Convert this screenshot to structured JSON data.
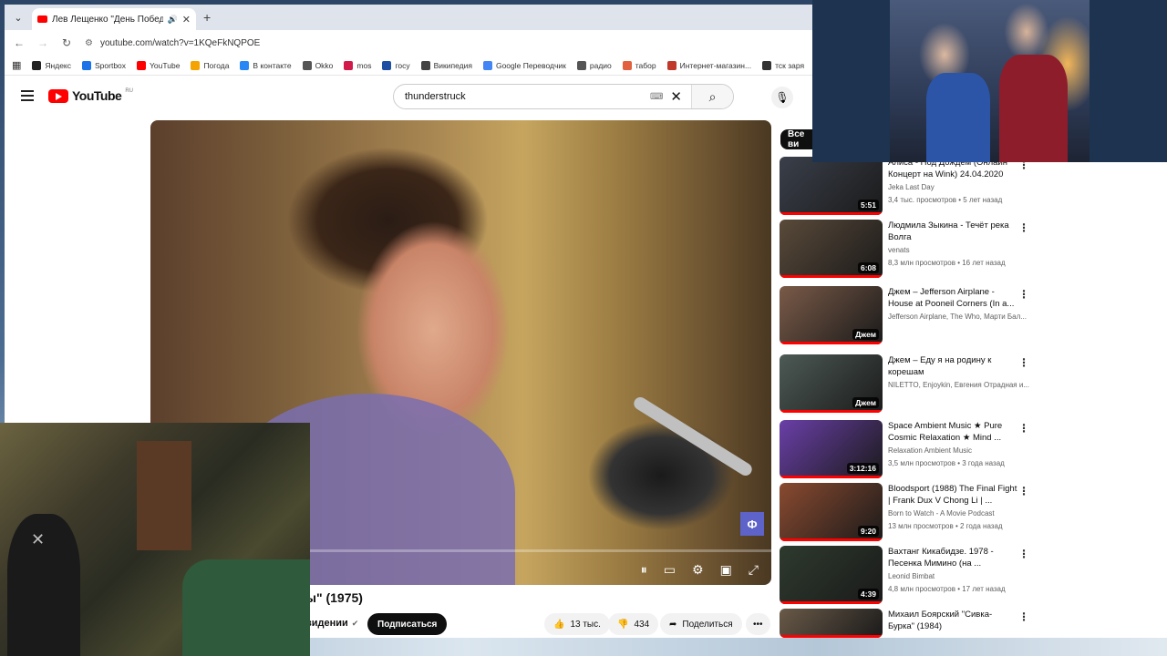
{
  "browser": {
    "tab_title": "Лев Лещенко \"День Побед",
    "url": "youtube.com/watch?v=1KQeFkNQPOE",
    "bookmarks": [
      "Яндекс",
      "Sportbox",
      "YouTube",
      "Погода",
      "В контакте",
      "Okko",
      "mos",
      "госу",
      "Википедия",
      "Google Переводчик",
      "радио",
      "табор",
      "Интернет-магазин...",
      "тск заря"
    ],
    "bookmark_colors": [
      "#222222",
      "#1a73e8",
      "#ff0000",
      "#f4a300",
      "#2787f5",
      "#555555",
      "#d11a4a",
      "#1e4fa3",
      "#444444",
      "#4285f4",
      "#555555",
      "#e06040",
      "#c0392b",
      "#333333"
    ]
  },
  "youtube": {
    "logo_text": "YouTube",
    "region": "RU",
    "search_query": "thunderstruck",
    "filter_chip": "Все ви",
    "video_title_partial": "ы\" (1975)",
    "channel_partial": "видении",
    "subscribe_label": "Подписаться",
    "likes": "13 тыс.",
    "dislikes": "434",
    "share_label": "Поделиться",
    "progress": 0.06
  },
  "recommendations": [
    {
      "title": "Алиса - Под Дождём (Онлайн Концерт на Wink) 24.04.2020",
      "channel": "Jeka Last Day",
      "meta": "3,4 тыс. просмотров • 5 лет назад",
      "badge": "5:51",
      "thumb": "#3a3f4a"
    },
    {
      "title": "Людмила Зыкина - Течёт река Волга",
      "channel": "venats",
      "meta": "8,3 млн просмотров • 16 лет назад",
      "badge": "6:08",
      "thumb": "#5a4a3a"
    },
    {
      "title": "Джем – Jefferson Airplane - House at Pooneil Corners (In a...",
      "channel": "Jefferson Airplane, The Who, Марти Бал...",
      "meta": "",
      "badge": "Джем",
      "thumb": "#7a5a48"
    },
    {
      "title": "Джем – Еду я на родину к корешам",
      "channel": "NILETTO, Enjoykin, Евгения Отрадная и...",
      "meta": "",
      "badge": "Джем",
      "thumb": "#4d5a55"
    },
    {
      "title": "Space Ambient  Music ★ Pure Cosmic Relaxation ★ Mind ...",
      "channel": "Relaxation Ambient Music",
      "meta": "3,5 млн просмотров • 3 года назад",
      "badge": "3:12:16",
      "thumb": "#6a3fa8"
    },
    {
      "title": "Bloodsport (1988) The Final Fight | Frank Dux V Chong Li | ...",
      "channel": "Born to Watch - A Movie Podcast",
      "meta": "13 млн просмотров • 2 года назад",
      "badge": "9:20",
      "thumb": "#8a4a30"
    },
    {
      "title": "Вахтанг Кикабидзе. 1978 - Песенка Мимино (на ...",
      "channel": "Leonid Bimbat",
      "meta": "4,8 млн просмотров • 17 лет назад",
      "badge": "4:39",
      "thumb": "#2e3a2e"
    },
    {
      "title": "Михаил Боярский \"Сивка-Бурка\" (1984)",
      "channel": "",
      "meta": "",
      "badge": "",
      "thumb": "#6a5a48"
    }
  ]
}
